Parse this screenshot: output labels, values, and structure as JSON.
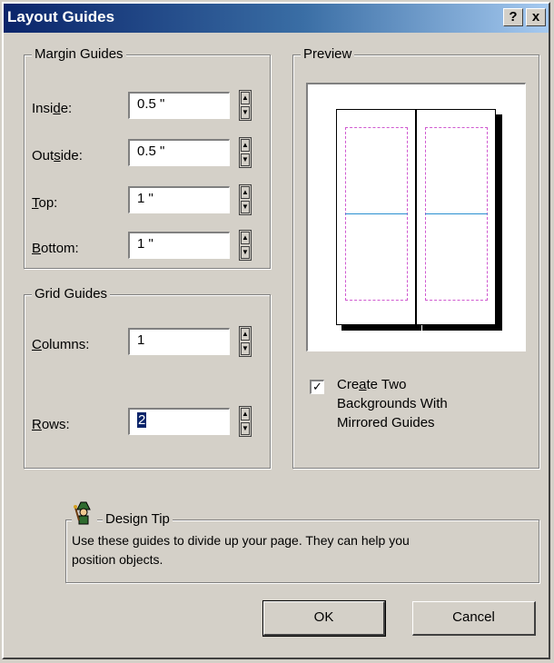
{
  "window": {
    "title": "Layout Guides",
    "help_button": "?",
    "close_button": "x"
  },
  "margin_guides": {
    "legend": "Margin Guides",
    "inside": {
      "label_pre": "Insi",
      "label_u": "d",
      "label_post": "e:",
      "value": "0.5 \""
    },
    "outside": {
      "label_pre": "Out",
      "label_u": "s",
      "label_post": "ide:",
      "value": "0.5 \""
    },
    "top": {
      "label_pre": "",
      "label_u": "T",
      "label_post": "op:",
      "value": "1 \""
    },
    "bottom": {
      "label_pre": "",
      "label_u": "B",
      "label_post": "ottom:",
      "value": "1 \""
    }
  },
  "grid_guides": {
    "legend": "Grid Guides",
    "columns": {
      "label_pre": "",
      "label_u": "C",
      "label_post": "olumns:",
      "value": "1"
    },
    "rows": {
      "label_pre": "",
      "label_u": "R",
      "label_post": "ows:",
      "value": "2"
    }
  },
  "preview": {
    "legend": "Preview",
    "checkbox_checked": true,
    "checkbox_mark": "✓",
    "checkbox_line1_pre": "Cre",
    "checkbox_line1_u": "a",
    "checkbox_line1_post": "te Two",
    "checkbox_line2": "Backgrounds With",
    "checkbox_line3": "Mirrored Guides"
  },
  "design_tip": {
    "title": "Design Tip",
    "icon": "wizard-icon",
    "text_line1": "Use these guides to divide up your page.  They can help you",
    "text_line2": "position objects."
  },
  "buttons": {
    "ok": "OK",
    "cancel": "Cancel"
  },
  "colors": {
    "title_bar_start": "#0a246a",
    "title_bar_end": "#a6caf0",
    "margin_guide": "#d05ad0",
    "row_guide": "#2a8fd0",
    "dialog_bg": "#d4d0c8"
  }
}
